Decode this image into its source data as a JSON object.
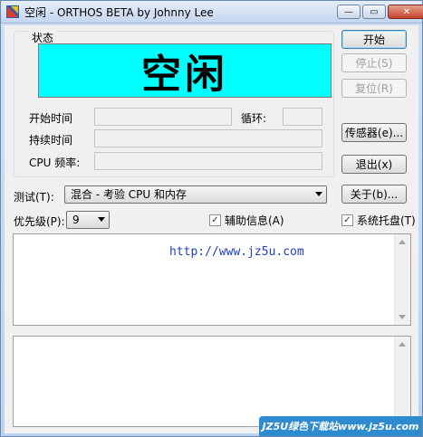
{
  "window": {
    "title": "空闲 - ORTHOS BETA by Johnny Lee",
    "minimize_glyph": "—",
    "maximize_glyph": "▭",
    "close_glyph": "✕",
    "icon": "orthos-app-icon"
  },
  "status_group": {
    "label": "状态",
    "display_text": "空闲",
    "display_color": "#00ffff",
    "start_time_label": "开始时间",
    "start_time_value": "",
    "loop_label": "循环:",
    "loop_value": "",
    "duration_label": "持续时间",
    "duration_value": "",
    "cpu_freq_label": "CPU 频率:",
    "cpu_freq_value": ""
  },
  "buttons": {
    "start": "开始",
    "stop": "停止(S)",
    "reset": "复位(R)",
    "sensor": "传感器(e)...",
    "exit": "退出(x)",
    "about": "关于(b)..."
  },
  "test": {
    "label": "测试(T):",
    "selected": "混合 - 考验 CPU 和内存"
  },
  "priority": {
    "label": "优先级(P):",
    "selected": "9"
  },
  "checkboxes": {
    "aux_info": {
      "label": "辅助信息(A)",
      "checked": true,
      "glyph": "✓"
    },
    "system_tray": {
      "label": "系统托盘(T)",
      "checked": true,
      "glyph": "✓"
    }
  },
  "log": {
    "url_text": "http://www.jz5u.com",
    "url_color": "#1f3fbf"
  },
  "watermark": {
    "text": "JZ5U绿色下载站www.jz5u.com"
  }
}
